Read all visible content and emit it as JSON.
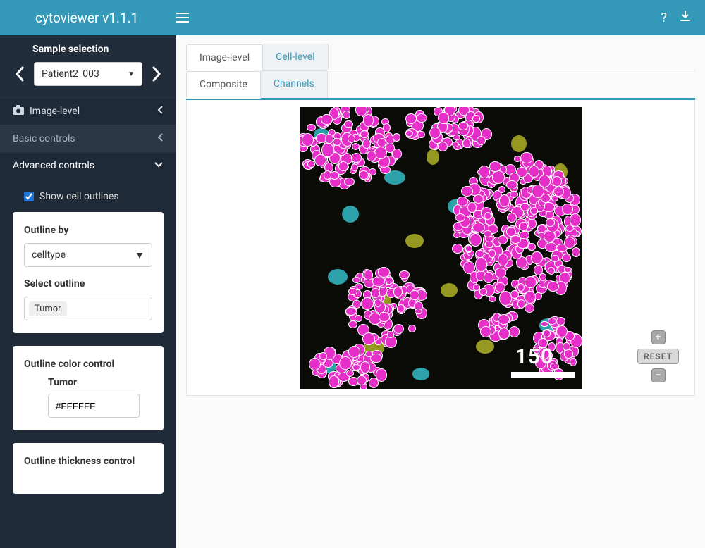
{
  "header": {
    "title": "cytoviewer v1.1.1"
  },
  "sidebar": {
    "sample_label": "Sample selection",
    "sample_value": "Patient2_003",
    "menu": {
      "image_level": "Image-level",
      "basic": "Basic controls",
      "advanced": "Advanced controls"
    },
    "show_outlines_label": "Show cell outlines",
    "show_outlines_checked": true,
    "outline_by_label": "Outline by",
    "outline_by_value": "celltype",
    "select_outline_label": "Select outline",
    "select_outline_tag": "Tumor",
    "color_control_title": "Outline color control",
    "color_field_label": "Tumor",
    "color_value": "#FFFFFF",
    "thickness_title": "Outline thickness control"
  },
  "tabs": {
    "image_level": "Image-level",
    "cell_level": "Cell-level",
    "composite": "Composite",
    "channels": "Channels"
  },
  "viewer": {
    "scale_label": "150",
    "reset_label": "RESET"
  }
}
